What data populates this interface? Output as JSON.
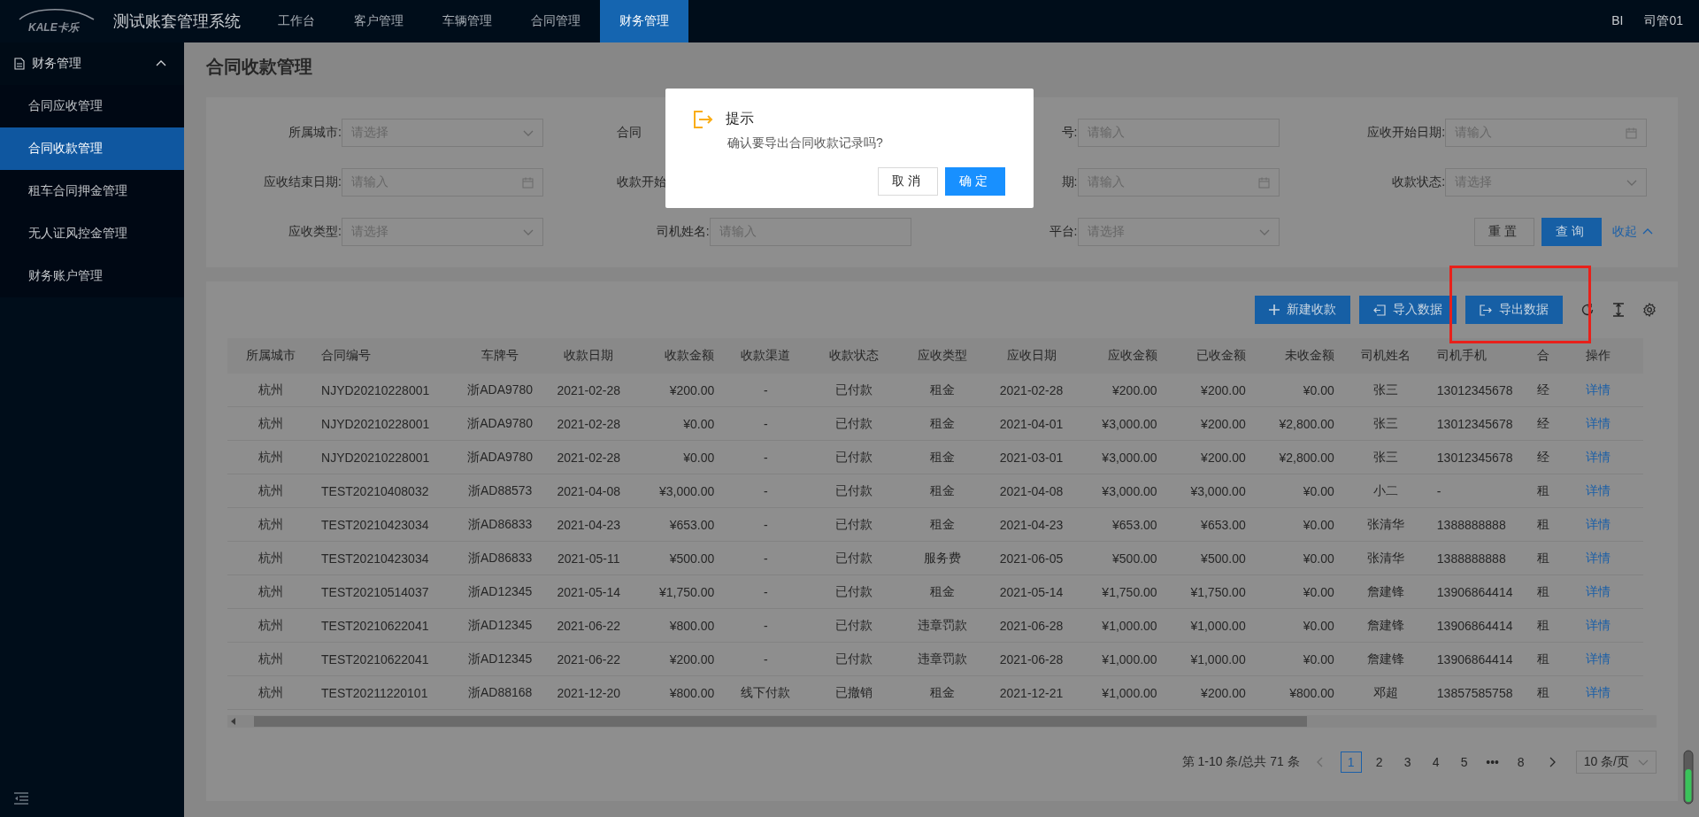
{
  "topbar": {
    "logo_text": "KALE卡乐",
    "app_title": "测试账套管理系统",
    "tabs": [
      {
        "label": "工作台",
        "selected": false
      },
      {
        "label": "客户管理",
        "selected": false
      },
      {
        "label": "车辆管理",
        "selected": false
      },
      {
        "label": "合同管理",
        "selected": false
      },
      {
        "label": "财务管理",
        "selected": true
      }
    ],
    "right_items": [
      "BI",
      "司管01"
    ]
  },
  "sidebar": {
    "group": {
      "label": "财务管理",
      "expanded": true,
      "items": [
        {
          "label": "合同应收管理",
          "selected": false
        },
        {
          "label": "合同收款管理",
          "selected": true
        },
        {
          "label": "租车合同押金管理",
          "selected": false
        },
        {
          "label": "无人证风控金管理",
          "selected": false
        },
        {
          "label": "财务账户管理",
          "selected": false
        }
      ]
    }
  },
  "page_title": "合同收款管理",
  "filters": [
    {
      "label": "所属城市:",
      "kind": "select",
      "placeholder": "请选择"
    },
    {
      "label": "合同",
      "kind": "covered"
    },
    {
      "label": "号:",
      "kind": "input",
      "placeholder": "请输入"
    },
    {
      "label": "应收开始日期:",
      "kind": "date",
      "placeholder": "请输入"
    },
    {
      "label": "应收结束日期:",
      "kind": "date",
      "placeholder": "请输入"
    },
    {
      "label": "收款开始",
      "kind": "covered"
    },
    {
      "label": "期:",
      "kind": "date",
      "placeholder": "请输入"
    },
    {
      "label": "收款状态:",
      "kind": "select",
      "placeholder": "请选择"
    },
    {
      "label": "应收类型:",
      "kind": "select",
      "placeholder": "请选择"
    },
    {
      "label": "司机姓名:",
      "kind": "input",
      "placeholder": "请输入"
    },
    {
      "label": "平台:",
      "kind": "select",
      "placeholder": "请选择"
    }
  ],
  "filter_actions": {
    "reset": "重置",
    "query": "查询",
    "collapse": "收起"
  },
  "toolbar": {
    "buttons": [
      {
        "label": "新建收款",
        "kind": "add"
      },
      {
        "label": "导入数据",
        "kind": "import"
      },
      {
        "label": "导出数据",
        "kind": "export"
      }
    ]
  },
  "table": {
    "columns": [
      "所属城市",
      "合同编号",
      "车牌号",
      "收款日期",
      "收款金额",
      "收款渠道",
      "收款状态",
      "应收类型",
      "应收日期",
      "应收金额",
      "已收金额",
      "未收金额",
      "司机姓名",
      "司机手机",
      "合",
      "操作"
    ],
    "rows": [
      [
        "杭州",
        "NJYD20210228001",
        "浙ADA9780",
        "2021-02-28",
        "¥200.00",
        "-",
        "已付款",
        "租金",
        "2021-02-28",
        "¥200.00",
        "¥200.00",
        "¥0.00",
        "张三",
        "13012345678",
        "经",
        "详情"
      ],
      [
        "杭州",
        "NJYD20210228001",
        "浙ADA9780",
        "2021-02-28",
        "¥0.00",
        "-",
        "已付款",
        "租金",
        "2021-04-01",
        "¥3,000.00",
        "¥200.00",
        "¥2,800.00",
        "张三",
        "13012345678",
        "经",
        "详情"
      ],
      [
        "杭州",
        "NJYD20210228001",
        "浙ADA9780",
        "2021-02-28",
        "¥0.00",
        "-",
        "已付款",
        "租金",
        "2021-03-01",
        "¥3,000.00",
        "¥200.00",
        "¥2,800.00",
        "张三",
        "13012345678",
        "经",
        "详情"
      ],
      [
        "杭州",
        "TEST20210408032",
        "浙AD88573",
        "2021-04-08",
        "¥3,000.00",
        "-",
        "已付款",
        "租金",
        "2021-04-08",
        "¥3,000.00",
        "¥3,000.00",
        "¥0.00",
        "小二",
        "-",
        "租",
        "详情"
      ],
      [
        "杭州",
        "TEST20210423034",
        "浙AD86833",
        "2021-04-23",
        "¥653.00",
        "-",
        "已付款",
        "租金",
        "2021-04-23",
        "¥653.00",
        "¥653.00",
        "¥0.00",
        "张清华",
        "1388888888",
        "租",
        "详情"
      ],
      [
        "杭州",
        "TEST20210423034",
        "浙AD86833",
        "2021-05-11",
        "¥500.00",
        "-",
        "已付款",
        "服务费",
        "2021-06-05",
        "¥500.00",
        "¥500.00",
        "¥0.00",
        "张清华",
        "1388888888",
        "租",
        "详情"
      ],
      [
        "杭州",
        "TEST20210514037",
        "浙AD12345",
        "2021-05-14",
        "¥1,750.00",
        "-",
        "已付款",
        "租金",
        "2021-05-14",
        "¥1,750.00",
        "¥1,750.00",
        "¥0.00",
        "詹建锋",
        "13906864414",
        "租",
        "详情"
      ],
      [
        "杭州",
        "TEST20210622041",
        "浙AD12345",
        "2021-06-22",
        "¥800.00",
        "-",
        "已付款",
        "违章罚款",
        "2021-06-28",
        "¥1,000.00",
        "¥1,000.00",
        "¥0.00",
        "詹建锋",
        "13906864414",
        "租",
        "详情"
      ],
      [
        "杭州",
        "TEST20210622041",
        "浙AD12345",
        "2021-06-22",
        "¥200.00",
        "-",
        "已付款",
        "违章罚款",
        "2021-06-28",
        "¥1,000.00",
        "¥1,000.00",
        "¥0.00",
        "詹建锋",
        "13906864414",
        "租",
        "详情"
      ],
      [
        "杭州",
        "TEST20211220101",
        "浙AD88168",
        "2021-12-20",
        "¥800.00",
        "线下付款",
        "已撤销",
        "租金",
        "2021-12-21",
        "¥1,000.00",
        "¥200.00",
        "¥800.00",
        "邓超",
        "13857585758",
        "租",
        "详情"
      ]
    ]
  },
  "pagination": {
    "summary": "第 1-10 条/总共 71 条",
    "pages": [
      {
        "label": "1",
        "selected": true
      },
      {
        "label": "2",
        "selected": false
      },
      {
        "label": "3",
        "selected": false
      },
      {
        "label": "4",
        "selected": false
      },
      {
        "label": "5",
        "selected": false
      },
      {
        "label": "•••",
        "selected": false
      },
      {
        "label": "8",
        "selected": false
      }
    ],
    "page_size": "10 条/页"
  },
  "dialog": {
    "title": "提示",
    "message": "确认要导出合同收款记录吗?",
    "cancel": "取消",
    "ok": "确定"
  }
}
